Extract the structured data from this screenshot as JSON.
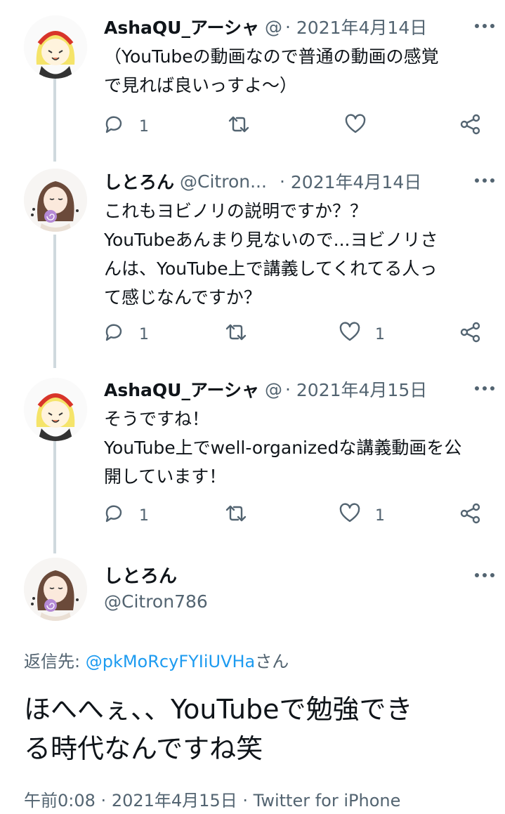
{
  "thread": [
    {
      "name": "AshaQU_アーシャ",
      "handle": "@",
      "sep": "·",
      "date": "2021年4月14日",
      "text": "（YouTubeの動画なので普通の動画の感覚\nで見れば良いっすよ〜）",
      "replies": "1",
      "likes": ""
    },
    {
      "name": "しとろん",
      "handle": "@Citron...",
      "sep": "·",
      "date": "2021年4月14日",
      "text": "これもヨビノリの説明ですか？？\nYouTubeあんまり見ないので...ヨビノリさ\nんは、YouTube上で講義してくれてる人っ\nて感じなんですか？",
      "replies": "1",
      "likes": "1"
    },
    {
      "name": "AshaQU_アーシャ",
      "handle": "@",
      "sep": "·",
      "date": "2021年4月15日",
      "text": "そうですね！\nYouTube上でwell-organizedな講義動画を公\n開しています！",
      "replies": "1",
      "likes": "1"
    }
  ],
  "main": {
    "name": "しとろん",
    "handle": "@Citron786",
    "reply_to_prefix": "返信先: ",
    "reply_to_user": "@pkMoRcyFYIiUVHa",
    "reply_to_suffix": "さん",
    "text": "ほへへぇ、、YouTubeで勉強でき\nる時代なんですね笑",
    "time": "午前0:08",
    "date": "2021年4月15日",
    "source": "Twitter for iPhone",
    "sep": "·"
  },
  "icons": [
    "more-icon",
    "reply-icon",
    "retweet-icon",
    "like-icon",
    "share-icon"
  ],
  "colors": {
    "text": "#0f1419",
    "muted": "#536471",
    "link": "#1d9bf0",
    "line": "#cfd9de"
  }
}
